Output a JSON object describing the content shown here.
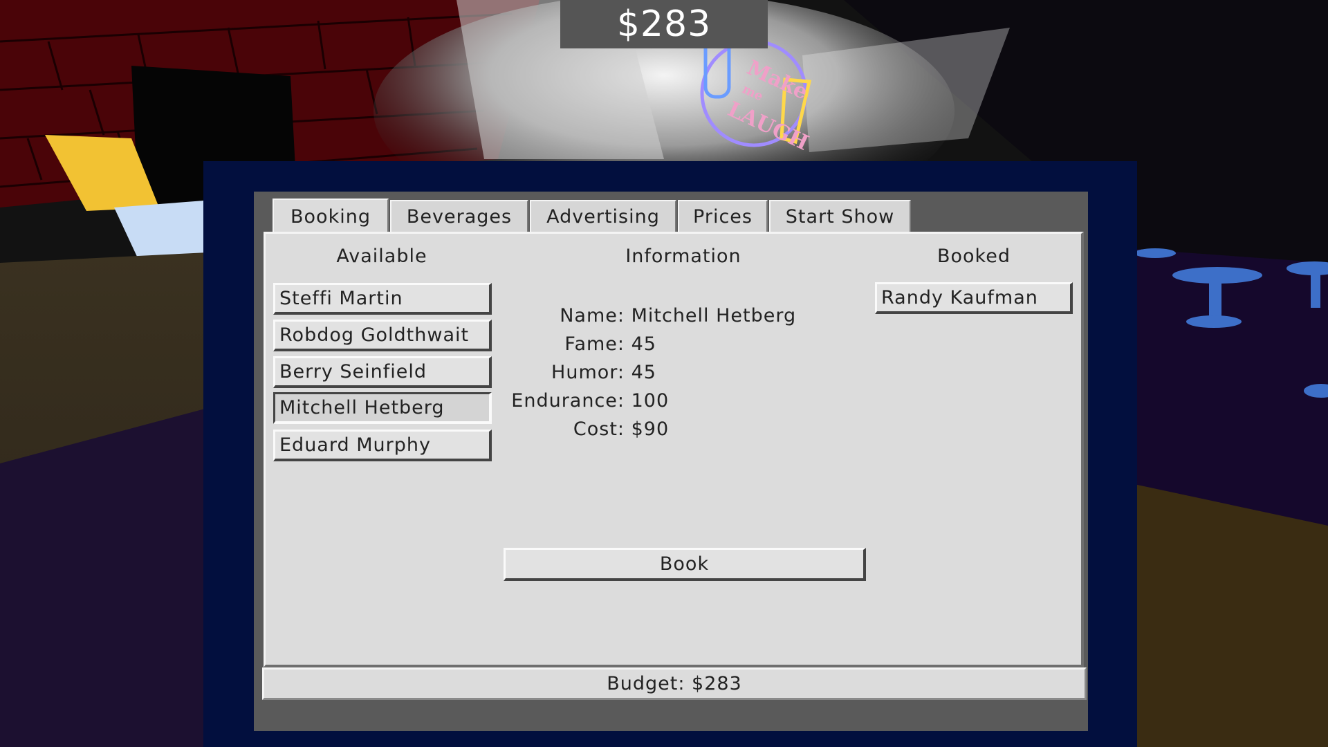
{
  "hud": {
    "money": "$283"
  },
  "sign": {
    "line1": "Make",
    "line2": "me",
    "line3": "LAUGH"
  },
  "tabs": [
    {
      "label": "Booking",
      "active": true
    },
    {
      "label": "Beverages",
      "active": false
    },
    {
      "label": "Advertising",
      "active": false
    },
    {
      "label": "Prices",
      "active": false
    },
    {
      "label": "Start Show",
      "active": false
    }
  ],
  "columns": {
    "available": "Available",
    "information": "Information",
    "booked": "Booked"
  },
  "available": [
    "Steffi Martin",
    "Robdog Goldthwait",
    "Berry Seinfield",
    "Mitchell Hetberg",
    "Eduard Murphy"
  ],
  "selected": "Mitchell Hetberg",
  "info": {
    "name_label": "Name:",
    "name": "Mitchell Hetberg",
    "fame_label": "Fame:",
    "fame": "45",
    "humor_label": "Humor:",
    "humor": "45",
    "endurance_label": "Endurance:",
    "endurance": "100",
    "cost_label": "Cost:",
    "cost": "$90"
  },
  "booked": [
    "Randy Kaufman"
  ],
  "book_label": "Book",
  "budget": "Budget: $283",
  "colors": {
    "frame": "#020f3e",
    "panel": "#dcdcdc",
    "brick": "#4a0408",
    "table": "#3d6fc8"
  }
}
